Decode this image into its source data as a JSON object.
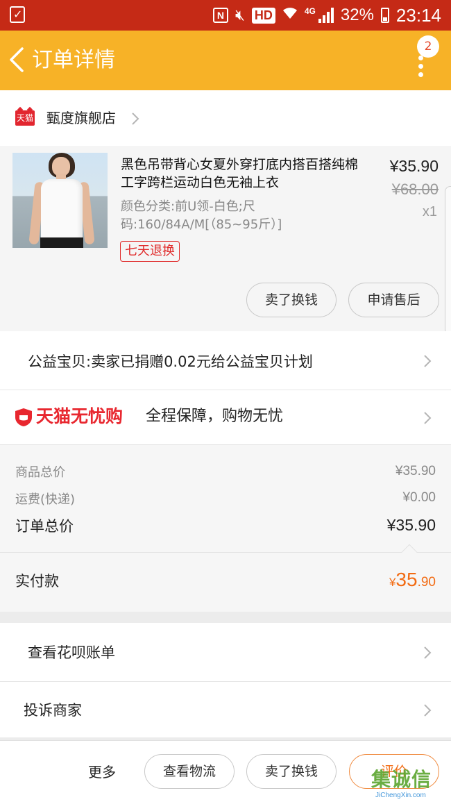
{
  "status_bar": {
    "battery": "32%",
    "time": "23:14",
    "hd": "HD",
    "network": "4G",
    "icons": [
      "checkbox-icon",
      "nfc-icon",
      "mute-icon",
      "wifi-icon",
      "signal-icon",
      "battery-icon"
    ]
  },
  "header": {
    "title": "订单详情",
    "badge": "2"
  },
  "shop": {
    "name": "甄度旗舰店",
    "logo_text": "天猫"
  },
  "product": {
    "title": "黑色吊带背心女夏外穿打底内搭百搭纯棉工字跨栏运动白色无袖上衣",
    "spec": "颜色分类:前U领-白色;尺码:160/84A/M[（85~95斤）]",
    "tag": "七天退换",
    "price": "¥35.90",
    "original_price": "¥68.00",
    "quantity": "x1",
    "buttons": [
      "卖了换钱",
      "申请售后"
    ]
  },
  "charity": {
    "text": "公益宝贝:卖家已捐赠0.02元给公益宝贝计划"
  },
  "guarantee": {
    "brand": "天猫无忧购",
    "text": "全程保障，购物无忧"
  },
  "summary": {
    "goods_total_label": "商品总价",
    "goods_total_value": "¥35.90",
    "shipping_label": "运费(快递)",
    "shipping_value": "¥0.00",
    "order_total_label": "订单总价",
    "order_total_value": "¥35.90"
  },
  "paid": {
    "label": "实付款",
    "currency": "¥",
    "integer": "35",
    "decimal": ".90"
  },
  "links": {
    "huabei": "查看花呗账单",
    "complain": "投诉商家"
  },
  "bottom_bar": {
    "more": "更多",
    "logistics": "查看物流",
    "resell": "卖了换钱",
    "review": "评价"
  },
  "watermark": {
    "cn": "集诚信",
    "en": "JiChengXin.com"
  },
  "colors": {
    "status_bar": "#c52a16",
    "header": "#f7b227",
    "tmall_red": "#e8272f",
    "accent_orange": "#f26b13"
  }
}
